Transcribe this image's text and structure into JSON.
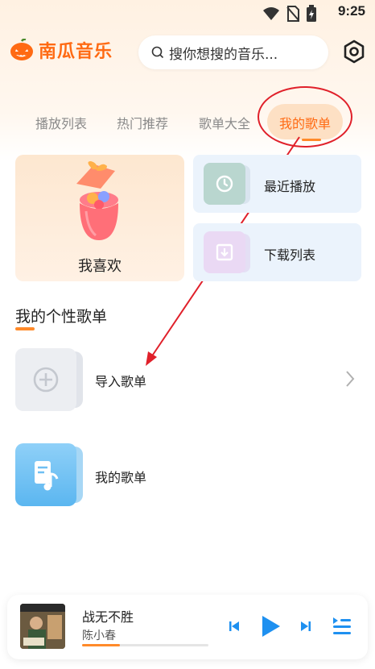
{
  "status_bar": {
    "time": "9:25"
  },
  "header": {
    "app_name": "南瓜音乐",
    "search_placeholder": "搜你想搜的音乐..."
  },
  "tabs": [
    {
      "label": "播放列表",
      "active": false
    },
    {
      "label": "热门推荐",
      "active": false
    },
    {
      "label": "歌单大全",
      "active": false
    },
    {
      "label": "我的歌单",
      "active": true
    }
  ],
  "cards": {
    "favorites": "我喜欢",
    "recent": "最近播放",
    "downloads": "下载列表"
  },
  "section": {
    "title": "我的个性歌单",
    "rows": [
      {
        "label": "导入歌单"
      },
      {
        "label": "我的歌单"
      }
    ]
  },
  "player": {
    "title": "战无不胜",
    "artist": "陈小春",
    "progress": 0.3
  },
  "colors": {
    "accent": "#ff6a13",
    "annotation": "#e0202a"
  }
}
